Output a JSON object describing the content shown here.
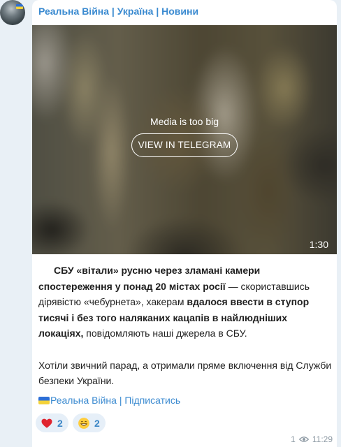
{
  "channel": {
    "name": "Реальна Війна | Україна | Новини",
    "avatar_icon": "soldier-avatar"
  },
  "media": {
    "note": "Media is too big",
    "button_label": "VIEW IN TELEGRAM",
    "duration": "1:30"
  },
  "message": {
    "p1_a": "СБУ «вітали» русню через зламані камери спостереження у понад 20 містах росії",
    "p1_b": " — скориставшись дірявістю «чебурнета», хакерам ",
    "p1_c": "вдалося ввести в ступор тисячі і без того наляканих кацапів в найлюдніших локаціях,",
    "p1_d": " повідомляють наші джерела в СБУ.",
    "p2": "Хотіли звичний парад, а отримали пряме включення від Служби безпеки України.",
    "promo": "Реальна Війна | Підписатись"
  },
  "reactions": [
    {
      "emoji": "heart-emoji",
      "count": "2"
    },
    {
      "emoji": "grin-emoji",
      "count": "2"
    }
  ],
  "meta": {
    "views": "1",
    "time": "11:29"
  },
  "colors": {
    "background": "#e9f0f6",
    "accent": "#3a8ad0",
    "reaction_bg": "#e6eff8"
  }
}
